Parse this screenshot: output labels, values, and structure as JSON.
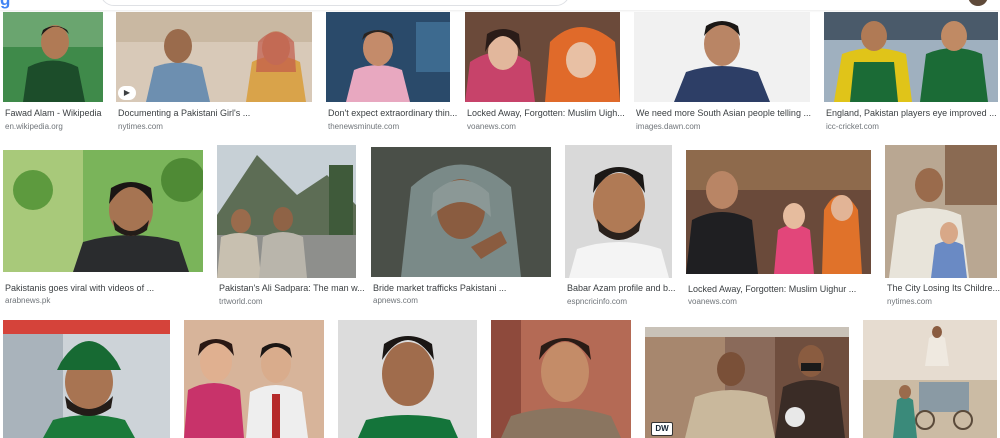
{
  "header": {
    "logo_fragment": "g",
    "search_value": ""
  },
  "results": [
    {
      "caption": "Fawad Alam - Wikipedia",
      "source": "en.wikipedia.org"
    },
    {
      "caption": "Documenting a Pakistani Girl's ...",
      "source": "nytimes.com"
    },
    {
      "caption": "Don't expect extraordinary thin...",
      "source": "thenewsminute.com"
    },
    {
      "caption": "Locked Away, Forgotten: Muslim Uigh...",
      "source": "voanews.com"
    },
    {
      "caption": "We need more South Asian people telling ...",
      "source": "images.dawn.com"
    },
    {
      "caption": "England, Pakistan players eye improved ...",
      "source": "icc-cricket.com"
    },
    {
      "caption": "Pakistanis goes viral with videos of ...",
      "source": "arabnews.pk"
    },
    {
      "caption": "Pakistan's Ali Sadpara: The man w...",
      "source": "trtworld.com"
    },
    {
      "caption": "Bride market trafficks Pakistani ...",
      "source": "apnews.com"
    },
    {
      "caption": "Babar Azam profile and b...",
      "source": "espncricinfo.com"
    },
    {
      "caption": "Locked Away, Forgotten: Muslim Uighur ...",
      "source": "voanews.com"
    },
    {
      "caption": "The City Losing Its Childre...",
      "source": "nytimes.com"
    }
  ],
  "overlays": {
    "play_icon": "▶",
    "dw_logo": "DW"
  }
}
